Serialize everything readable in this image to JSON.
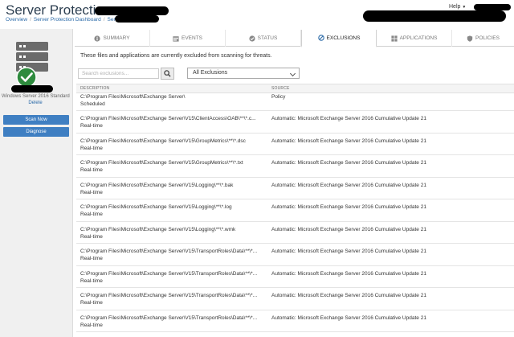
{
  "header": {
    "title": "Server Protection -",
    "breadcrumbs": [
      "Overview",
      "Server Protection Dashboard",
      "Servers"
    ],
    "help_label": "Help"
  },
  "sidebar": {
    "os_label": "Windows Server 2016 Standard",
    "delete_label": "Delete",
    "scan_button": "Scan Now",
    "diagnose_button": "Diagnose"
  },
  "tabs": [
    {
      "label": "Summary",
      "icon": "info-icon"
    },
    {
      "label": "Events",
      "icon": "calendar-icon"
    },
    {
      "label": "Status",
      "icon": "check-circle-icon"
    },
    {
      "label": "Exclusions",
      "icon": "block-icon"
    },
    {
      "label": "Applications",
      "icon": "grid-icon"
    },
    {
      "label": "Policies",
      "icon": "shield-icon"
    }
  ],
  "main": {
    "info_text": "These files and applications are currently excluded from scanning for threats.",
    "search_placeholder": "Search exclusions...",
    "filter_value": "All Exclusions",
    "columns": {
      "description": "DESCRIPTION",
      "source": "SOURCE"
    }
  },
  "rows": [
    {
      "path": "C:\\Program Files\\Microsoft\\Exchange Server\\",
      "type": "Scheduled",
      "source": "Policy"
    },
    {
      "path": "C:\\Program Files\\Microsoft\\Exchange Server\\V15\\ClientAccess\\OAB\\**\\*.c...",
      "type": "Real-time",
      "source": "Automatic: Microsoft Exchange Server 2016 Cumulative Update 21"
    },
    {
      "path": "C:\\Program Files\\Microsoft\\Exchange Server\\V15\\GroupMetrics\\**\\*.dsc",
      "type": "Real-time",
      "source": "Automatic: Microsoft Exchange Server 2016 Cumulative Update 21"
    },
    {
      "path": "C:\\Program Files\\Microsoft\\Exchange Server\\V15\\GroupMetrics\\**\\*.txt",
      "type": "Real-time",
      "source": "Automatic: Microsoft Exchange Server 2016 Cumulative Update 21"
    },
    {
      "path": "C:\\Program Files\\Microsoft\\Exchange Server\\V15\\Logging\\**\\*.bak",
      "type": "Real-time",
      "source": "Automatic: Microsoft Exchange Server 2016 Cumulative Update 21"
    },
    {
      "path": "C:\\Program Files\\Microsoft\\Exchange Server\\V15\\Logging\\**\\*.log",
      "type": "Real-time",
      "source": "Automatic: Microsoft Exchange Server 2016 Cumulative Update 21"
    },
    {
      "path": "C:\\Program Files\\Microsoft\\Exchange Server\\V15\\Logging\\**\\*.wmk",
      "type": "Real-time",
      "source": "Automatic: Microsoft Exchange Server 2016 Cumulative Update 21"
    },
    {
      "path": "C:\\Program Files\\Microsoft\\Exchange Server\\V15\\TransportRoles\\Data\\**\\*...",
      "type": "Real-time",
      "source": "Automatic: Microsoft Exchange Server 2016 Cumulative Update 21"
    },
    {
      "path": "C:\\Program Files\\Microsoft\\Exchange Server\\V15\\TransportRoles\\Data\\**\\*...",
      "type": "Real-time",
      "source": "Automatic: Microsoft Exchange Server 2016 Cumulative Update 21"
    },
    {
      "path": "C:\\Program Files\\Microsoft\\Exchange Server\\V15\\TransportRoles\\Data\\**\\*...",
      "type": "Real-time",
      "source": "Automatic: Microsoft Exchange Server 2016 Cumulative Update 21"
    },
    {
      "path": "C:\\Program Files\\Microsoft\\Exchange Server\\V15\\TransportRoles\\Data\\**\\*...",
      "type": "Real-time",
      "source": "Automatic: Microsoft Exchange Server 2016 Cumulative Update 21"
    }
  ],
  "colors": {
    "accent": "#3f7fc2",
    "link": "#2b6aa8",
    "status_ok": "#2e8b3e"
  }
}
